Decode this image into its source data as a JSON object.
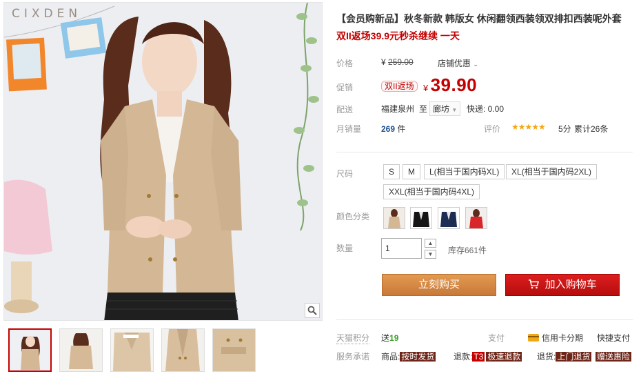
{
  "gallery": {
    "brand_watermark": "CIXDEN",
    "zoom_icon": "magnifier-icon",
    "thumbnails": [
      {
        "name": "thumb-1",
        "active": true
      },
      {
        "name": "thumb-2",
        "active": false
      },
      {
        "name": "thumb-3",
        "active": false
      },
      {
        "name": "thumb-4",
        "active": false
      },
      {
        "name": "thumb-5",
        "active": false
      }
    ]
  },
  "product": {
    "title": "【会员购新品】秋冬新款 韩版女 休闲翻领西装领双排扣西装呢外套",
    "subtitle": "双II返场39.9元秒杀继续 一天"
  },
  "price": {
    "label": "价格",
    "original": "259.00",
    "currency": "¥",
    "store_discount": "店铺优惠",
    "promo_label": "促销",
    "promo_tag": "双II返场",
    "promo_price": "39.90"
  },
  "shipping": {
    "label": "配送",
    "from": "福建泉州",
    "to_word": "至",
    "destination": "廊坊",
    "express": "快递: 0.00"
  },
  "sales": {
    "label": "月销量",
    "count": "269",
    "unit": "件",
    "rating_label": "评价",
    "stars": "★★★★★",
    "score": "5分",
    "review_count": "累计26条"
  },
  "options": {
    "size_label": "尺码",
    "sizes": [
      "S",
      "M",
      "L(相当于国内码XL)",
      "XL(相当于国内码2XL)",
      "XXL(相当于国内码4XL)"
    ],
    "color_label": "颜色分类",
    "color_swatches": [
      "beige",
      "black",
      "navy",
      "red"
    ],
    "qty_label": "数量",
    "qty_value": "1",
    "stock": "库存661件"
  },
  "actions": {
    "buy_now": "立刻购买",
    "add_to_cart": "加入购物车"
  },
  "footer": {
    "points_label": "天猫积分",
    "points_text": "送",
    "points_value": "19",
    "pay_label": "支付",
    "credit_card": "信用卡分期",
    "quick_pay": "快捷支付",
    "service_label": "服务承诺",
    "goods_label": "商品:",
    "goods_tag": "按时发货",
    "refund_label": "退款:",
    "t3_tag": "T3",
    "refund_tag": "极速退款",
    "return_label": "退货:",
    "return_tag": "上门退货",
    "gift_tag": "赠送惠险"
  },
  "colors": {
    "accent_red": "#c40000",
    "buy_orange": "#d38640",
    "cart_red": "#c81212",
    "star_gold": "#f3a712"
  }
}
